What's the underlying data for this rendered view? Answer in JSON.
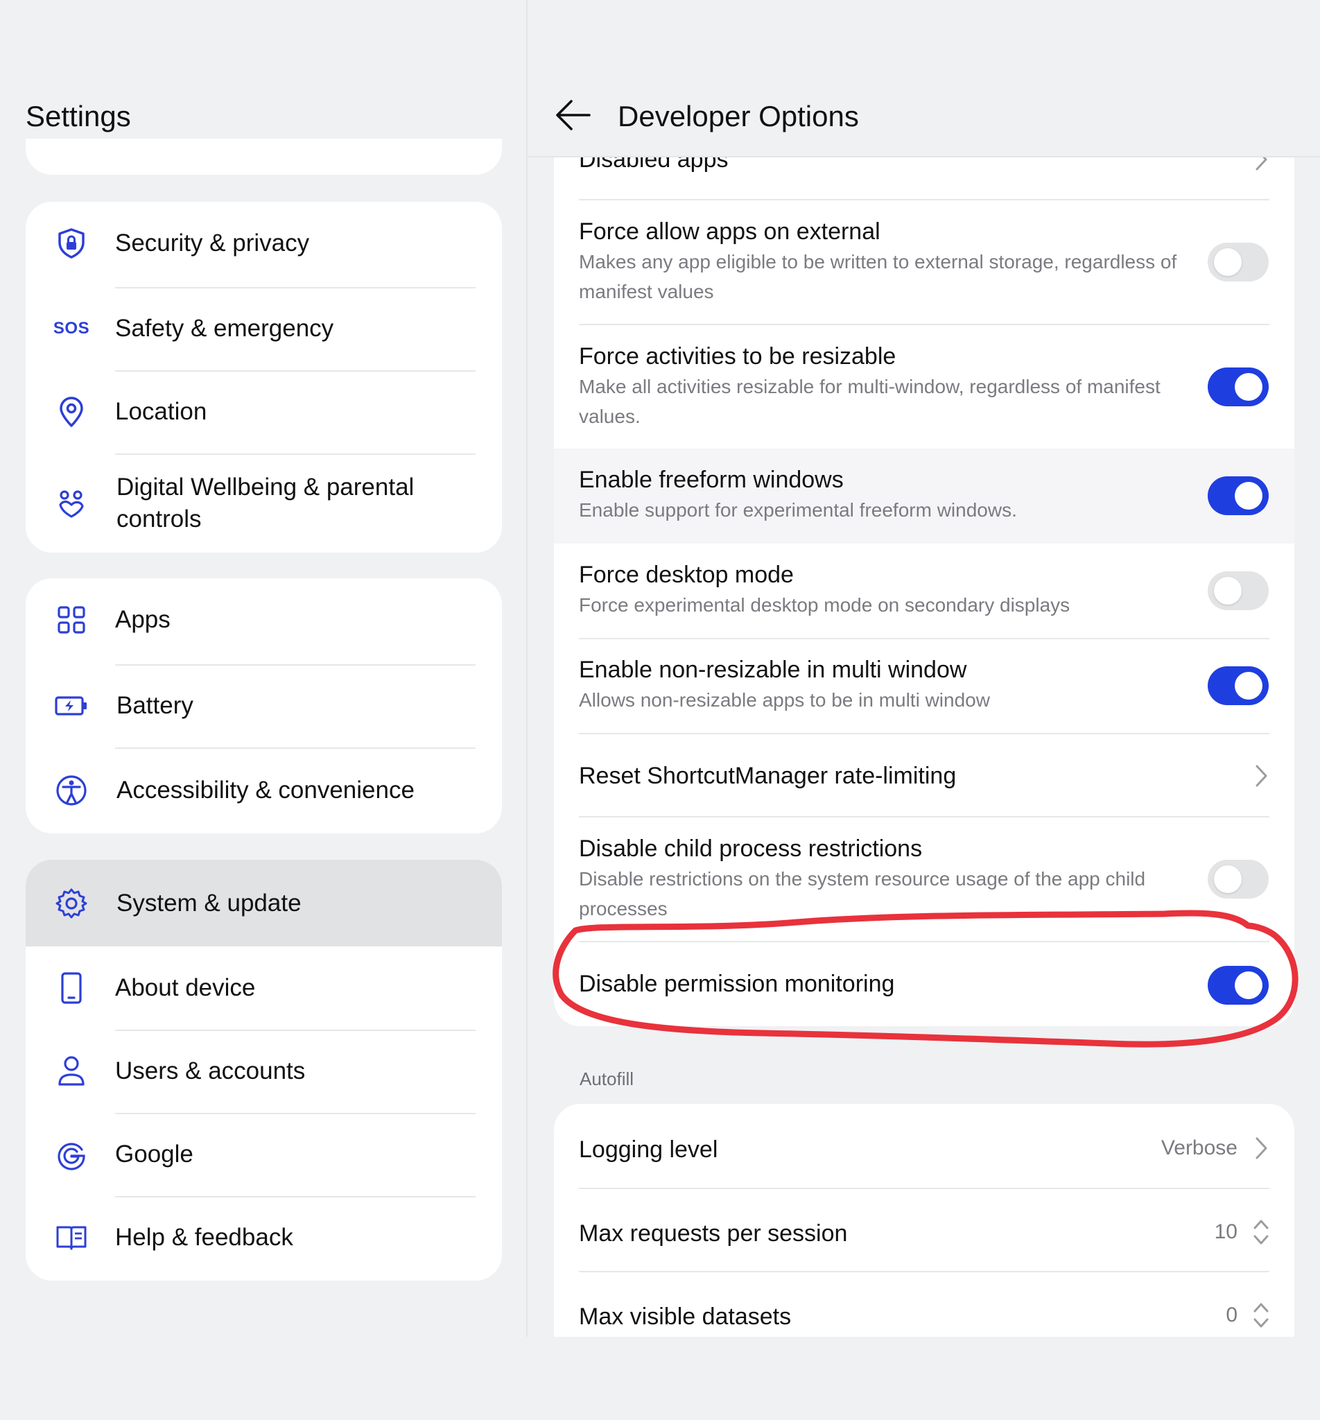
{
  "left": {
    "title": "Settings",
    "items": [
      {
        "label": "Security & privacy",
        "icon": "shield-lock-icon"
      },
      {
        "label": "Safety & emergency",
        "icon_text": "SOS",
        "icon": "sos-icon"
      },
      {
        "label": "Location",
        "icon": "location-pin-icon"
      },
      {
        "label": "Digital Wellbeing & parental controls",
        "icon": "wellbeing-icon"
      },
      {
        "label": "Apps",
        "icon": "apps-grid-icon"
      },
      {
        "label": "Battery",
        "icon": "battery-icon"
      },
      {
        "label": "Accessibility & convenience",
        "icon": "accessibility-icon"
      },
      {
        "label": "System & update",
        "icon": "gear-icon"
      },
      {
        "label": "About device",
        "icon": "phone-icon"
      },
      {
        "label": "Users & accounts",
        "icon": "user-icon"
      },
      {
        "label": "Google",
        "icon": "google-icon"
      },
      {
        "label": "Help & feedback",
        "icon": "help-book-icon"
      }
    ]
  },
  "right": {
    "title": "Developer Options",
    "rows": [
      {
        "title": "Disabled apps",
        "type": "chevron"
      },
      {
        "title": "Force allow apps on external",
        "subtitle": "Makes any app eligible to be written to external storage, regardless of manifest values",
        "toggle": false
      },
      {
        "title": "Force activities to be resizable",
        "subtitle": "Make all activities resizable for multi-window, regardless of manifest values.",
        "toggle": true
      },
      {
        "title": "Enable freeform windows",
        "subtitle": "Enable support for experimental freeform windows.",
        "toggle": true
      },
      {
        "title": "Force desktop mode",
        "subtitle": "Force experimental desktop mode on secondary displays",
        "toggle": false
      },
      {
        "title": "Enable non-resizable in multi window",
        "subtitle": "Allows non-resizable apps to be in multi window",
        "toggle": true
      },
      {
        "title": "Reset ShortcutManager rate-limiting",
        "type": "chevron"
      },
      {
        "title": "Disable child process restrictions",
        "subtitle": "Disable restrictions on the system resource usage of the app child processes",
        "toggle": false
      },
      {
        "title": "Disable permission monitoring",
        "toggle": true
      }
    ],
    "autofill": {
      "section_label": "Autofill",
      "rows": [
        {
          "title": "Logging level",
          "value": "Verbose",
          "control": "chevron"
        },
        {
          "title": "Max requests per session",
          "value": "10",
          "control": "stepper"
        },
        {
          "title": "Max visible datasets",
          "value": "0",
          "control": "stepper"
        }
      ]
    }
  },
  "colors": {
    "accent": "#1f3ee0",
    "icon": "#2d3fd6",
    "annotation": "#e8323c",
    "background": "#f0f1f3"
  }
}
